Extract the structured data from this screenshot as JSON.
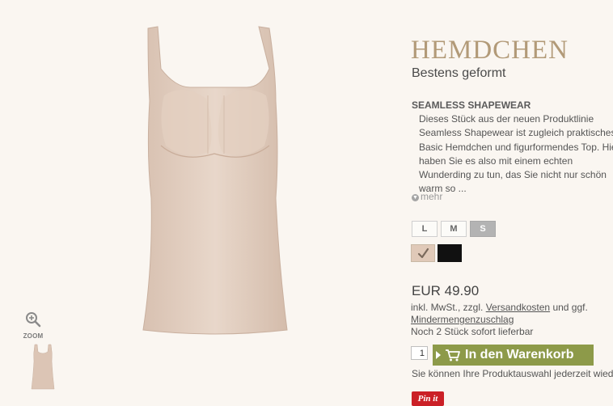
{
  "product": {
    "title": "HEMDCHEN",
    "subtitle": "Bestens geformt",
    "section_title": "SEAMLESS SHAPEWEAR",
    "description_lines": [
      "Dieses Stück aus der neuen Produktlinie",
      "Seamless Shapewear ist zugleich praktisches",
      "Basic Hemdchen und figurformendes Top. Hier",
      "haben Sie es also mit einem echten",
      "Wunderding zu tun, das Sie nicht nur schön",
      "warm so ..."
    ],
    "more_label": "mehr",
    "more_icon": "chevron-down-icon"
  },
  "gallery": {
    "zoom_label": "ZOOM",
    "zoom_icon": "zoom-in-icon"
  },
  "sizes": [
    {
      "label": "L",
      "selected": false
    },
    {
      "label": "M",
      "selected": false
    },
    {
      "label": "S",
      "selected": true
    }
  ],
  "colors": [
    {
      "name": "nude",
      "hex": "#e0c9b8",
      "selected": true
    },
    {
      "name": "black",
      "hex": "#111111",
      "selected": false
    }
  ],
  "pricing": {
    "price": "EUR 49.90",
    "tax_prefix": "inkl. MwSt., zzgl.",
    "shipping_link": "Versandkosten",
    "tax_suffix": "und ggf.",
    "min_surcharge_link": "Mindermengenzuschlag",
    "availability": "Noch 2 Stück sofort lieferbar"
  },
  "cart": {
    "quantity": "1",
    "button_label": "In den Warenkorb",
    "icon": "cart-icon",
    "note": "Sie können Ihre Produktauswahl jederzeit wieder"
  },
  "social": {
    "pinit_label": "Pin it"
  },
  "colors_theme": {
    "background": "#faf6f1",
    "title": "#b29a78",
    "cart_button": "#8d9a49",
    "selected_size": "#b3b3b3",
    "pinit": "#cb2027"
  }
}
